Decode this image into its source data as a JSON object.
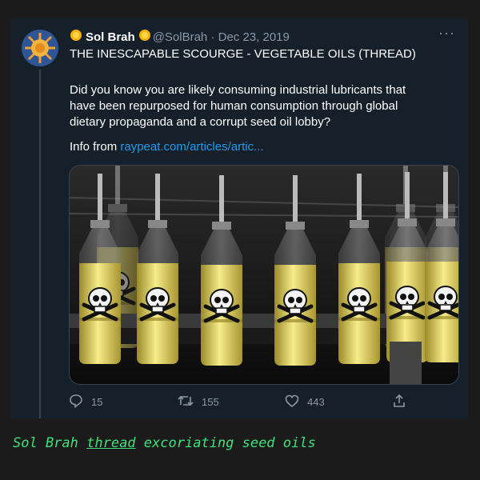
{
  "tweet": {
    "author_name": "Sol Brah",
    "handle_date": "@SolBrah · Dec 23, 2019",
    "title": "THE INESCAPABLE SCOURGE - VEGETABLE OILS (THREAD)",
    "body": "Did you know you are likely consuming industrial lubricants that have been repurposed for human consumption through global dietary propaganda and a corrupt seed oil lobby?",
    "info_prefix": "Info from ",
    "link": "raypeat.com/articles/artic...",
    "more": "···",
    "image_icon": "skull-and-crossbones-icon"
  },
  "actions": {
    "replies": "15",
    "retweets": "155",
    "likes": "443"
  },
  "caption": {
    "pre": "Sol Brah ",
    "link": "thread",
    "post": " excoriating seed oils"
  },
  "colors": {
    "background": "#1b1b1b",
    "card": "#15202b",
    "link": "#1d9bf0",
    "caption": "#3fe27a",
    "muted": "#8b98a5"
  }
}
